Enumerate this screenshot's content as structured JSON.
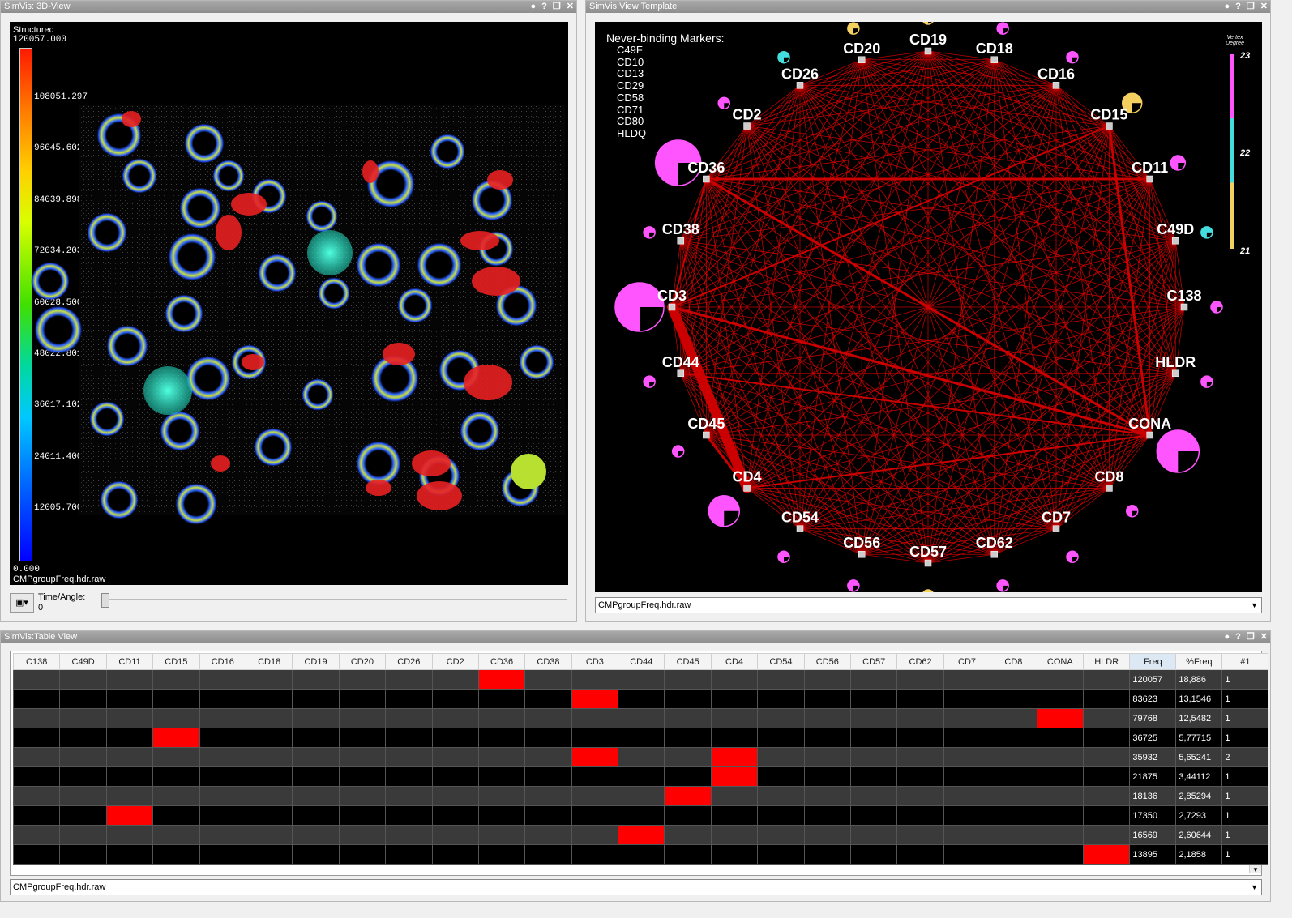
{
  "view3d": {
    "title": "SimVis: 3D-View",
    "legend_title": "Structured",
    "legend_max": "120057.000",
    "legend_ticks": [
      "108051.297",
      "96045.602",
      "84039.898",
      "72034.203",
      "60028.500",
      "48022.801",
      "36017.102",
      "24011.400",
      "12005.700"
    ],
    "legend_min": "0.000",
    "filename": "CMPgroupFreq.hdr.raw",
    "time_label": "Time/Angle:",
    "time_value": "0"
  },
  "template": {
    "title": "SimVis:View Template",
    "never_binding_title": "Never-binding Markers:",
    "never_binding": [
      "C49F",
      "CD10",
      "CD13",
      "CD29",
      "CD58",
      "CD71",
      "CD80",
      "HLDQ"
    ],
    "legend_title_1": "Vertex",
    "legend_title_2": "Degree",
    "legend_values": [
      "23",
      "22",
      "21"
    ],
    "dropdown": "CMPgroupFreq.hdr.raw",
    "nodes": [
      {
        "label": "CD19",
        "degree": 21
      },
      {
        "label": "CD18",
        "degree": 23
      },
      {
        "label": "CD16",
        "degree": 23
      },
      {
        "label": "CD15",
        "degree": 21
      },
      {
        "label": "CD11",
        "degree": 23
      },
      {
        "label": "C49D",
        "degree": 22
      },
      {
        "label": "C138",
        "degree": 23
      },
      {
        "label": "HLDR",
        "degree": 23
      },
      {
        "label": "CONA",
        "degree": 23
      },
      {
        "label": "CD8",
        "degree": 23
      },
      {
        "label": "CD7",
        "degree": 23
      },
      {
        "label": "CD62",
        "degree": 23
      },
      {
        "label": "CD57",
        "degree": 21
      },
      {
        "label": "CD56",
        "degree": 23
      },
      {
        "label": "CD54",
        "degree": 23
      },
      {
        "label": "CD4",
        "degree": 23
      },
      {
        "label": "CD45",
        "degree": 23
      },
      {
        "label": "CD44",
        "degree": 23
      },
      {
        "label": "CD3",
        "degree": 23
      },
      {
        "label": "CD38",
        "degree": 23
      },
      {
        "label": "CD36",
        "degree": 23
      },
      {
        "label": "CD2",
        "degree": 23
      },
      {
        "label": "CD26",
        "degree": 22
      },
      {
        "label": "CD20",
        "degree": 21
      }
    ],
    "colors": {
      "deg23": "#ff55ff",
      "deg22": "#44dddd",
      "deg21": "#f4d060",
      "edge": "#e00000"
    }
  },
  "table": {
    "title": "SimVis:Table View",
    "columns": [
      "C138",
      "C49D",
      "CD11",
      "CD15",
      "CD16",
      "CD18",
      "CD19",
      "CD20",
      "CD26",
      "CD2",
      "CD36",
      "CD38",
      "CD3",
      "CD44",
      "CD45",
      "CD4",
      "CD54",
      "CD56",
      "CD57",
      "CD62",
      "CD7",
      "CD8",
      "CONA",
      "HLDR",
      "Freq",
      "%Freq",
      "#1"
    ],
    "rows": [
      {
        "active": [
          "CD36"
        ],
        "freq": "120057",
        "pfreq": "18,886",
        "n": "1"
      },
      {
        "active": [
          "CD3"
        ],
        "freq": "83623",
        "pfreq": "13,1546",
        "n": "1"
      },
      {
        "active": [
          "CONA"
        ],
        "freq": "79768",
        "pfreq": "12,5482",
        "n": "1"
      },
      {
        "active": [
          "CD15"
        ],
        "freq": "36725",
        "pfreq": "5,77715",
        "n": "1"
      },
      {
        "active": [
          "CD3",
          "CD4"
        ],
        "freq": "35932",
        "pfreq": "5,65241",
        "n": "2"
      },
      {
        "active": [
          "CD4"
        ],
        "freq": "21875",
        "pfreq": "3,44112",
        "n": "1"
      },
      {
        "active": [
          "CD45"
        ],
        "freq": "18136",
        "pfreq": "2,85294",
        "n": "1"
      },
      {
        "active": [
          "CD11"
        ],
        "freq": "17350",
        "pfreq": "2,7293",
        "n": "1"
      },
      {
        "active": [
          "CD44"
        ],
        "freq": "16569",
        "pfreq": "2,60644",
        "n": "1"
      },
      {
        "active": [
          "HLDR"
        ],
        "freq": "13895",
        "pfreq": "2,1858",
        "n": "1"
      }
    ],
    "dropdown": "CMPgroupFreq.hdr.raw"
  }
}
